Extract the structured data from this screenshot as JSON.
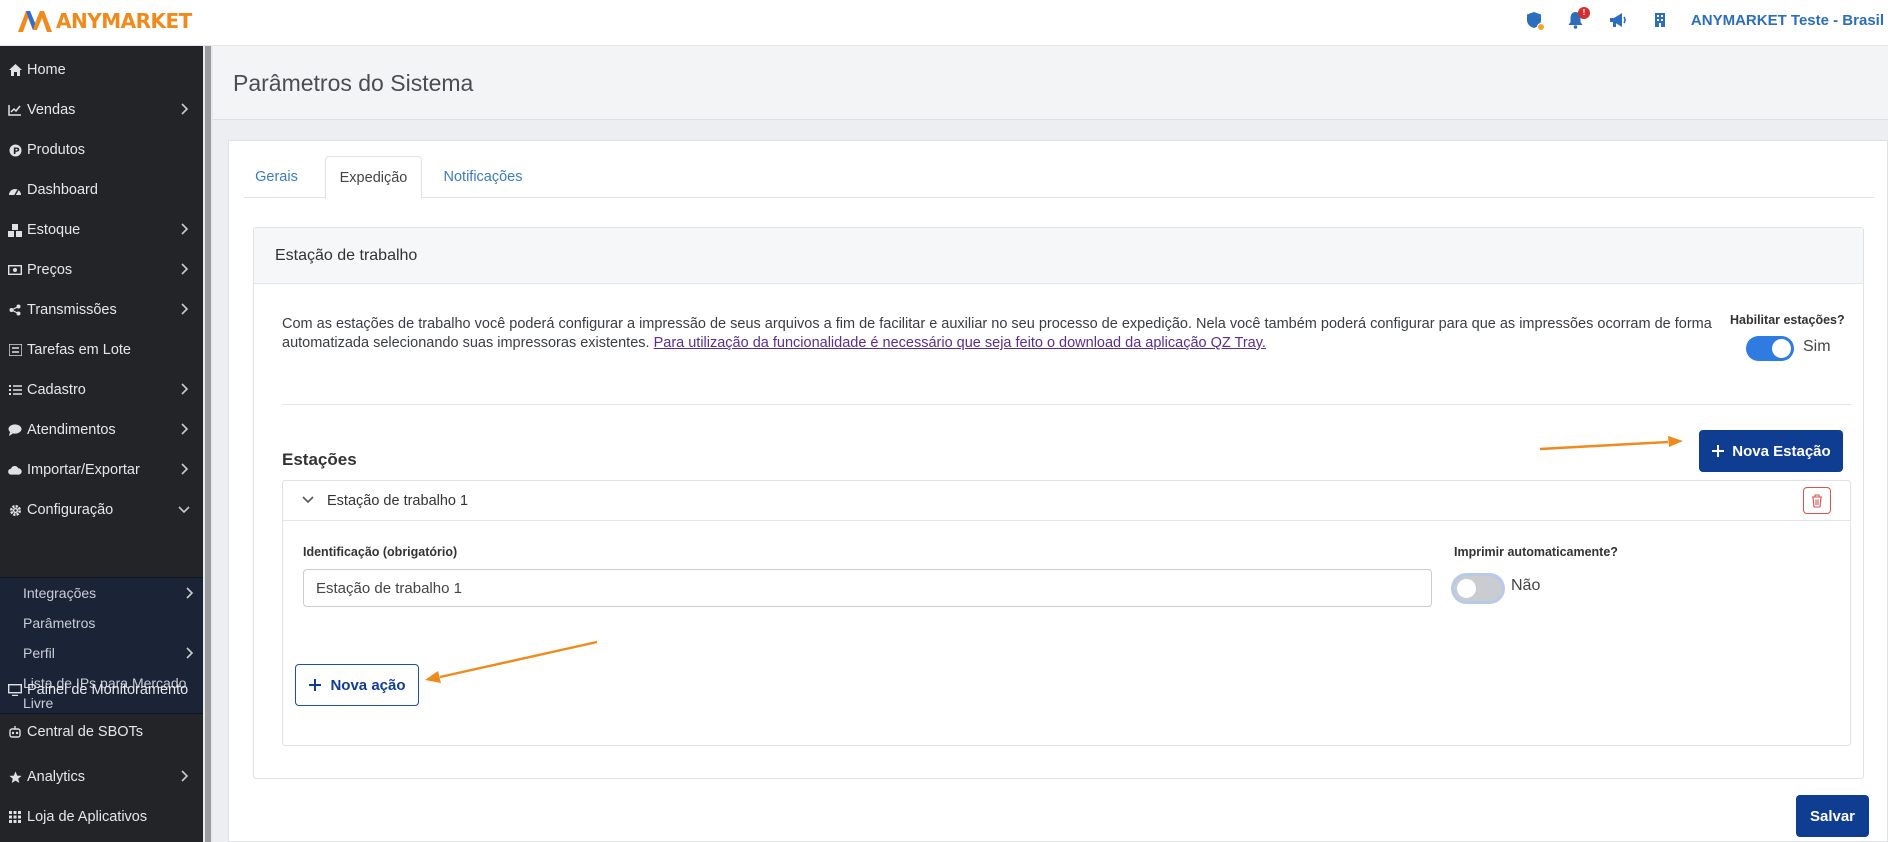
{
  "header": {
    "logo_text": "ANYMARKET",
    "notification_count": "!",
    "account_name": "ANYMARKET Teste - Brasil",
    "icons": [
      "shield-icon",
      "bell-icon",
      "megaphone-icon",
      "building-icon"
    ]
  },
  "sidebar": {
    "items": [
      {
        "label": "Home",
        "icon": "home-icon"
      },
      {
        "label": "Vendas",
        "icon": "chart-line-icon"
      },
      {
        "label": "Produtos",
        "icon": "product-icon"
      },
      {
        "label": "Dashboard",
        "icon": "dashboard-icon"
      },
      {
        "label": "Estoque",
        "icon": "cubes-icon"
      },
      {
        "label": "Preços",
        "icon": "money-icon"
      },
      {
        "label": "Transmissões",
        "icon": "share-icon"
      },
      {
        "label": "Tarefas em Lote",
        "icon": "list-icon"
      },
      {
        "label": "Cadastro",
        "icon": "list-ul-icon"
      },
      {
        "label": "Atendimentos",
        "icon": "comment-icon"
      },
      {
        "label": "Importar/Exportar",
        "icon": "cloud-icon"
      },
      {
        "label": "Configuração",
        "icon": "gear-icon"
      }
    ],
    "subitems": [
      {
        "label": "Integrações"
      },
      {
        "label": "Parâmetros"
      },
      {
        "label": "Perfil"
      },
      {
        "label": "Lista de IPs para Mercado Livre"
      }
    ],
    "bottom_items": [
      {
        "label": "Painel de Monitoramento",
        "icon": "monitor-icon"
      },
      {
        "label": "Central de SBOTs",
        "icon": "robot-icon"
      },
      {
        "label": "Analytics",
        "icon": "star-icon"
      },
      {
        "label": "Loja de Aplicativos",
        "icon": "grid-icon"
      }
    ]
  },
  "page": {
    "title": "Parâmetros do Sistema",
    "tabs": [
      {
        "label": "Gerais",
        "active": false
      },
      {
        "label": "Expedição",
        "active": true
      },
      {
        "label": "Notificações",
        "active": false
      }
    ]
  },
  "workstation": {
    "panel_title": "Estação de trabalho",
    "description": "Com as estações de trabalho você poderá configurar a impressão de seus arquivos a fim de facilitar e auxiliar no seu processo de expedição. Nela você também poderá configurar para que as impressões ocorram de forma automatizada selecionando suas impressoras existentes.",
    "link_text": "Para utilização da funcionalidade é necessário que seja feito o download da aplicação QZ Tray.",
    "enable_label": "Habilitar estações?",
    "enable_value": "Sim",
    "stations_title": "Estações",
    "new_station_button": "Nova Estação",
    "station": {
      "title": "Estação de trabalho 1",
      "id_label": "Identificação (obrigatório)",
      "id_value": "Estação de trabalho 1",
      "auto_print_label": "Imprimir automaticamente?",
      "auto_print_value": "Não",
      "new_action_button": "Nova ação"
    }
  },
  "footer": {
    "save_button": "Salvar"
  },
  "colors": {
    "brand_orange": "#f08a1c",
    "primary_blue": "#0f3d91",
    "link_blue": "#3b7bc1",
    "toggle_on": "#2f7be0",
    "sidebar_bg": "#232427",
    "annotation_arrow": "#f08a1c"
  }
}
